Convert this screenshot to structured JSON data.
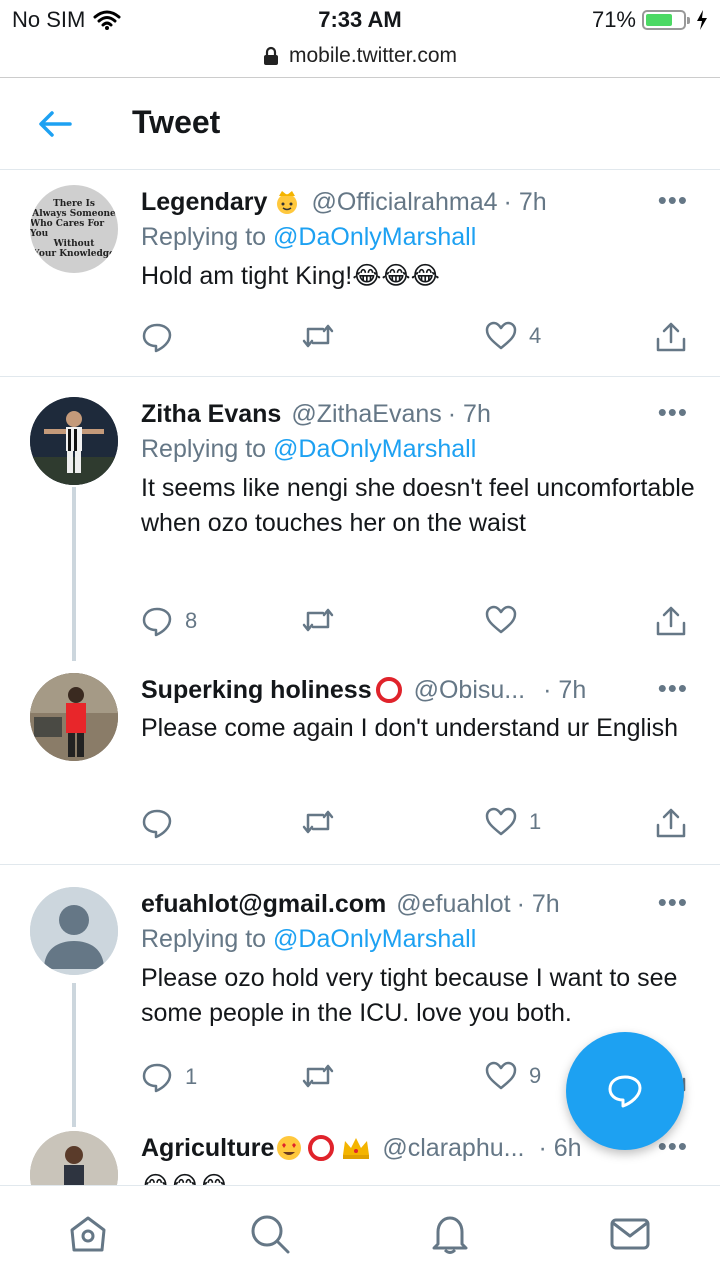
{
  "status_bar": {
    "carrier": "No SIM",
    "time": "7:33 AM",
    "battery_percent": "71%",
    "battery_level": 0.71
  },
  "address_bar": {
    "url": "mobile.twitter.com"
  },
  "header": {
    "title": "Tweet"
  },
  "tweets": [
    {
      "name": "Legendary",
      "handle": "@Officialrahma4",
      "time": "· 7h",
      "replying_label": "Replying to",
      "replying_to": "@DaOnlyMarshall",
      "text": "Hold am tight King!😂😂😂",
      "avatar_text": [
        "There Is",
        "Always Someone",
        "Who Cares For You",
        "Without",
        "Your Knowledge"
      ],
      "reply_count": "",
      "retweet_count": "",
      "like_count": "4"
    },
    {
      "name": "Zitha Evans",
      "handle": "@ZithaEvans",
      "time": "· 7h",
      "replying_label": "Replying to",
      "replying_to": "@DaOnlyMarshall",
      "text": "It seems like nengi she doesn't feel uncomfortable when ozo touches her on the waist",
      "reply_count": "8",
      "retweet_count": "",
      "like_count": ""
    },
    {
      "name": "Superking holiness",
      "handle": "@Obisu...",
      "time": "· 7h",
      "text": "Please come again I don't understand ur English",
      "reply_count": "",
      "retweet_count": "",
      "like_count": "1"
    },
    {
      "name": "efuahlot@gmail.com",
      "handle": "@efuahlot",
      "time": "· 7h",
      "replying_label": "Replying to",
      "replying_to": "@DaOnlyMarshall",
      "text": "Please ozo hold very tight because I want to see some people in the ICU. love you both.",
      "reply_count": "1",
      "retweet_count": "",
      "like_count": "9"
    },
    {
      "name": "Agriculture",
      "handle": "@claraphu...",
      "time": "· 6h",
      "text": "😂😂😂"
    }
  ],
  "colors": {
    "accent": "#1da1f2",
    "secondary_text": "#657786",
    "divider": "#e1e8ed"
  },
  "icons": [
    "back-arrow-icon",
    "reply-icon",
    "retweet-icon",
    "like-icon",
    "share-icon",
    "more-icon",
    "compose-reply-icon",
    "home-icon",
    "search-icon",
    "notifications-icon",
    "messages-icon"
  ]
}
